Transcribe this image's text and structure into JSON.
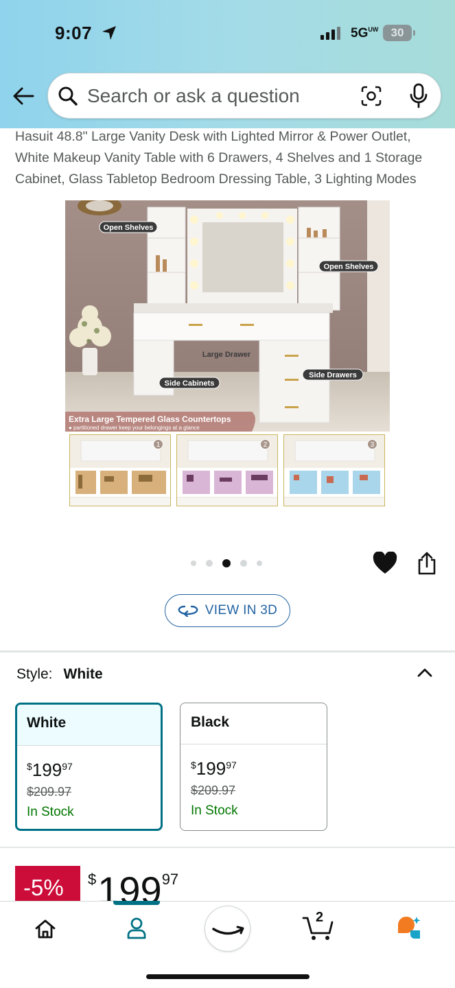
{
  "status_bar": {
    "time": "9:07",
    "network": "5G",
    "network_sup": "UW",
    "battery": "30"
  },
  "search": {
    "placeholder": "Search or ask a question"
  },
  "product": {
    "title": "Hasuit 48.8\" Large Vanity Desk with Lighted Mirror & Power Outlet, White Makeup Vanity Table with 6 Drawers, 4 Shelves and 1 Storage Cabinet, Glass Tabletop Bedroom Dressing Table, 3 Lighting Modes"
  },
  "image": {
    "callouts": {
      "open_shelves_left": "Open Shelves",
      "open_shelves_right": "Open Shelves",
      "large_drawer": "Large Drawer",
      "side_drawers": "Side Drawers",
      "side_cabinets": "Side Cabinets"
    },
    "banner_title": "Extra Large Tempered Glass Countertops",
    "banner_sub": "● partitioned drawer keep your belongings at a glance",
    "thumbnails": [
      "1",
      "2",
      "3"
    ],
    "carousel": {
      "count": 5,
      "active_index": 2
    }
  },
  "view3d_label": "VIEW IN 3D",
  "style": {
    "label": "Style:",
    "selected": "White",
    "options": [
      {
        "name": "White",
        "currency": "$",
        "whole": "199",
        "fraction": "97",
        "list_price": "$209.97",
        "stock": "In Stock",
        "selected": true
      },
      {
        "name": "Black",
        "currency": "$",
        "whole": "199",
        "fraction": "97",
        "list_price": "$209.97",
        "stock": "In Stock",
        "selected": false
      }
    ]
  },
  "deal": {
    "discount": "-5%",
    "currency": "$",
    "whole": "199",
    "fraction": "97"
  },
  "bottom_nav": {
    "cart_count": "2",
    "active": "account"
  },
  "colors": {
    "accent": "#007185",
    "deal_red": "#cc0c39",
    "stock_green": "#007600",
    "link_blue": "#2162a1"
  }
}
